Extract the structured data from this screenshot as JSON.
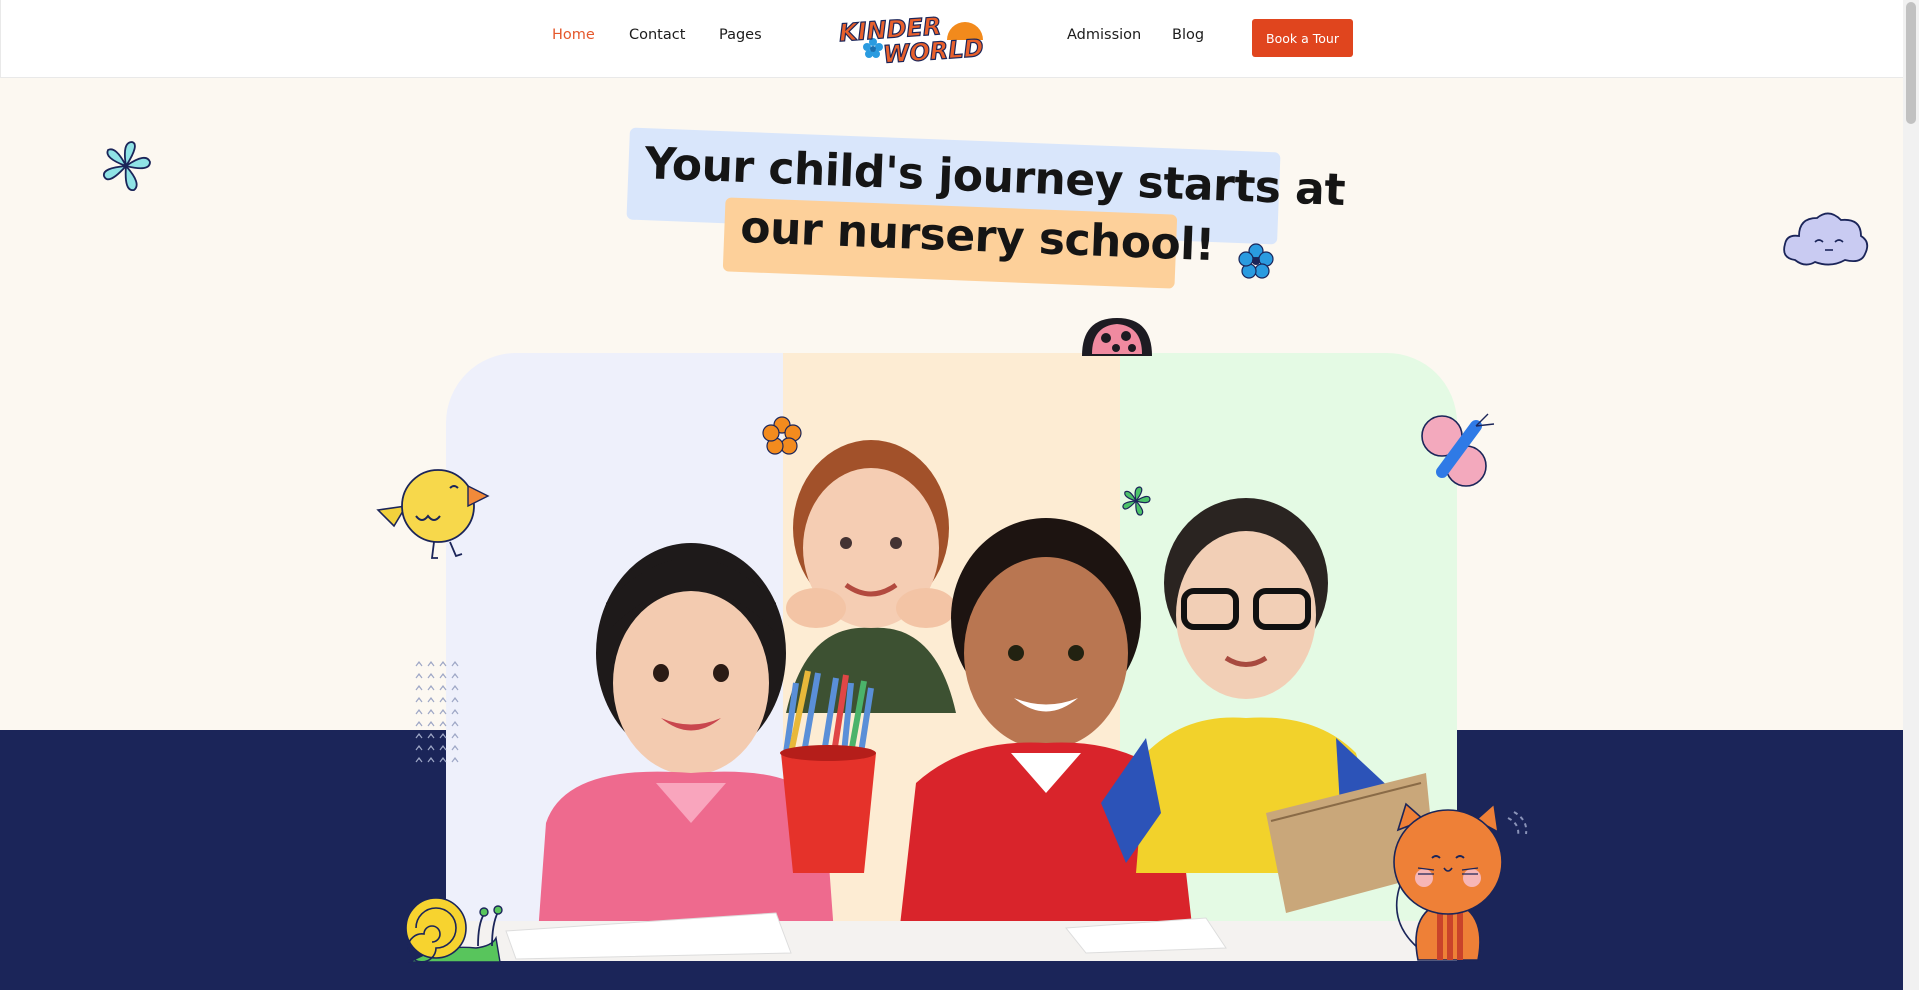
{
  "nav": {
    "left_links": [
      {
        "label": "Home",
        "active": true
      },
      {
        "label": "Contact",
        "active": false
      },
      {
        "label": "Pages",
        "active": false
      }
    ],
    "right_links": [
      {
        "label": "Admission",
        "active": false
      },
      {
        "label": "Blog",
        "active": false
      }
    ],
    "logo": {
      "line1": "KINDER",
      "line2": "WORLD"
    },
    "cta_label": "Book a Tour"
  },
  "hero": {
    "headline_line1": "Your child's journey starts at",
    "headline_line2": "our nursery school!"
  },
  "colors": {
    "accent": "#e0451e",
    "active_link": "#e5582b",
    "hero_bg": "#fcf8f1",
    "navy": "#1b2559",
    "highlight_blue": "#d9e6fb",
    "highlight_orange": "#fdd09a",
    "photo_col_1": "#eef0fb",
    "photo_col_2": "#fdecd3",
    "photo_col_3": "#e4fae4"
  },
  "decorations": [
    "flower-icon",
    "cloud-icon",
    "ladybug-icon",
    "bird-icon",
    "butterfly-icon",
    "snail-icon",
    "cat-icon",
    "dot-pattern"
  ]
}
